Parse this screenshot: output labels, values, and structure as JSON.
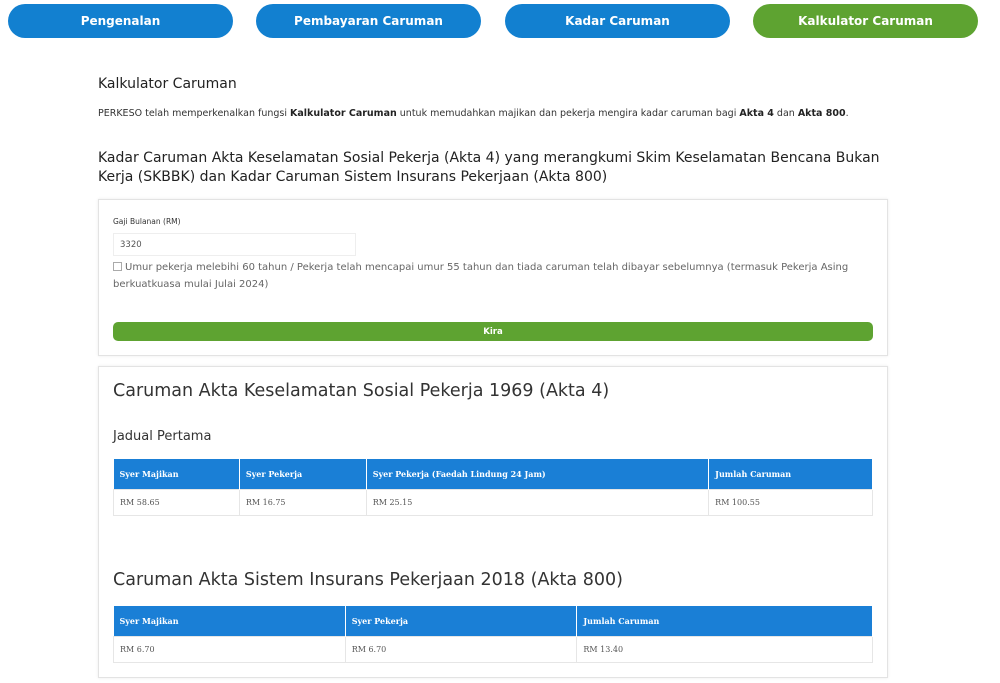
{
  "tabs": [
    {
      "label": "Pengenalan",
      "active": false
    },
    {
      "label": "Pembayaran Caruman",
      "active": false
    },
    {
      "label": "Kadar Caruman",
      "active": false
    },
    {
      "label": "Kalkulator Caruman",
      "active": true
    }
  ],
  "colors": {
    "tab_blue": "#1280d0",
    "tab_green": "#5ea331",
    "table_header": "#1a7fd6"
  },
  "page_title": "Kalkulator Caruman",
  "intro": {
    "part1": "PERKESO telah memperkenalkan fungsi ",
    "bold1": "Kalkulator Caruman",
    "part2": " untuk memudahkan majikan dan pekerja mengira kadar caruman bagi ",
    "bold2": "Akta 4",
    "part3": " dan ",
    "bold3": "Akta 800",
    "part4": "."
  },
  "heading": "Kadar Caruman Akta Keselamatan Sosial Pekerja (Akta 4) yang merangkumi Skim Keselamatan Bencana Bukan Kerja (SKBBK) dan Kadar Caruman Sistem Insurans Pekerjaan (Akta 800)",
  "form": {
    "salary_label": "Gaji Bulanan (RM)",
    "salary_value": "3320",
    "checkbox_checked": false,
    "checkbox_label": "Umur pekerja melebihi 60 tahun / Pekerja telah mencapai umur 55 tahun dan tiada caruman telah dibayar sebelumnya (termasuk Pekerja Asing berkuatkuasa mulai Julai 2024)",
    "button_label": "Kira"
  },
  "akta4": {
    "title": "Caruman Akta Keselamatan Sosial Pekerja 1969 (Akta 4)",
    "subtitle": "Jadual Pertama",
    "headers": [
      "Syer Majikan",
      "Syer Pekerja",
      "Syer Pekerja (Faedah Lindung 24 Jam)",
      "Jumlah Caruman"
    ],
    "row": [
      "RM 58.65",
      "RM 16.75",
      "RM 25.15",
      "RM 100.55"
    ]
  },
  "akta800": {
    "title": "Caruman Akta Sistem Insurans Pekerjaan 2018 (Akta 800)",
    "headers": [
      "Syer Majikan",
      "Syer Pekerja",
      "Jumlah Caruman"
    ],
    "row": [
      "RM 6.70",
      "RM 6.70",
      "RM 13.40"
    ]
  }
}
